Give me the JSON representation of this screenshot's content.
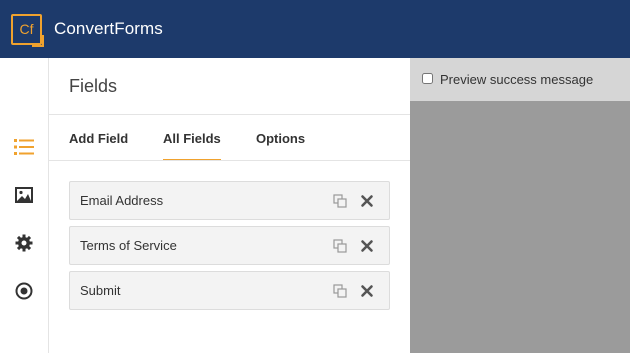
{
  "app": {
    "logo_text": "Cf",
    "brand": "ConvertForms"
  },
  "sidebar": {
    "icons": [
      "list-icon",
      "image-icon",
      "gear-icon",
      "target-icon"
    ]
  },
  "panel": {
    "title": "Fields",
    "tabs": [
      {
        "label": "Add Field",
        "active": false
      },
      {
        "label": "All Fields",
        "active": true
      },
      {
        "label": "Options",
        "active": false
      }
    ],
    "fields": [
      {
        "label": "Email Address"
      },
      {
        "label": "Terms of Service"
      },
      {
        "label": "Submit"
      }
    ]
  },
  "preview": {
    "checkbox_label": "Preview success message",
    "checked": false
  },
  "colors": {
    "topbar": "#1d3a6b",
    "accent": "#f0a22e",
    "preview_bg": "#9b9b9b"
  }
}
